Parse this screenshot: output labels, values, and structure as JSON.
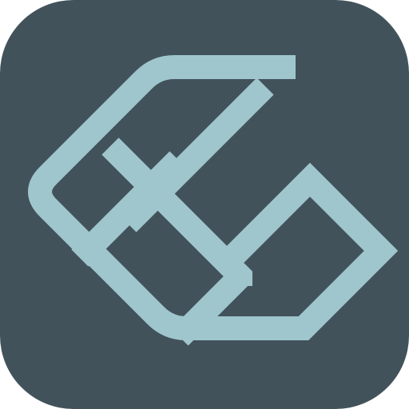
{
  "icon": {
    "name": "app-icon",
    "logo": "geometric-lattice-logo-icon",
    "colors": {
      "background": "#42525b",
      "mark": "#9fc6cd"
    }
  }
}
